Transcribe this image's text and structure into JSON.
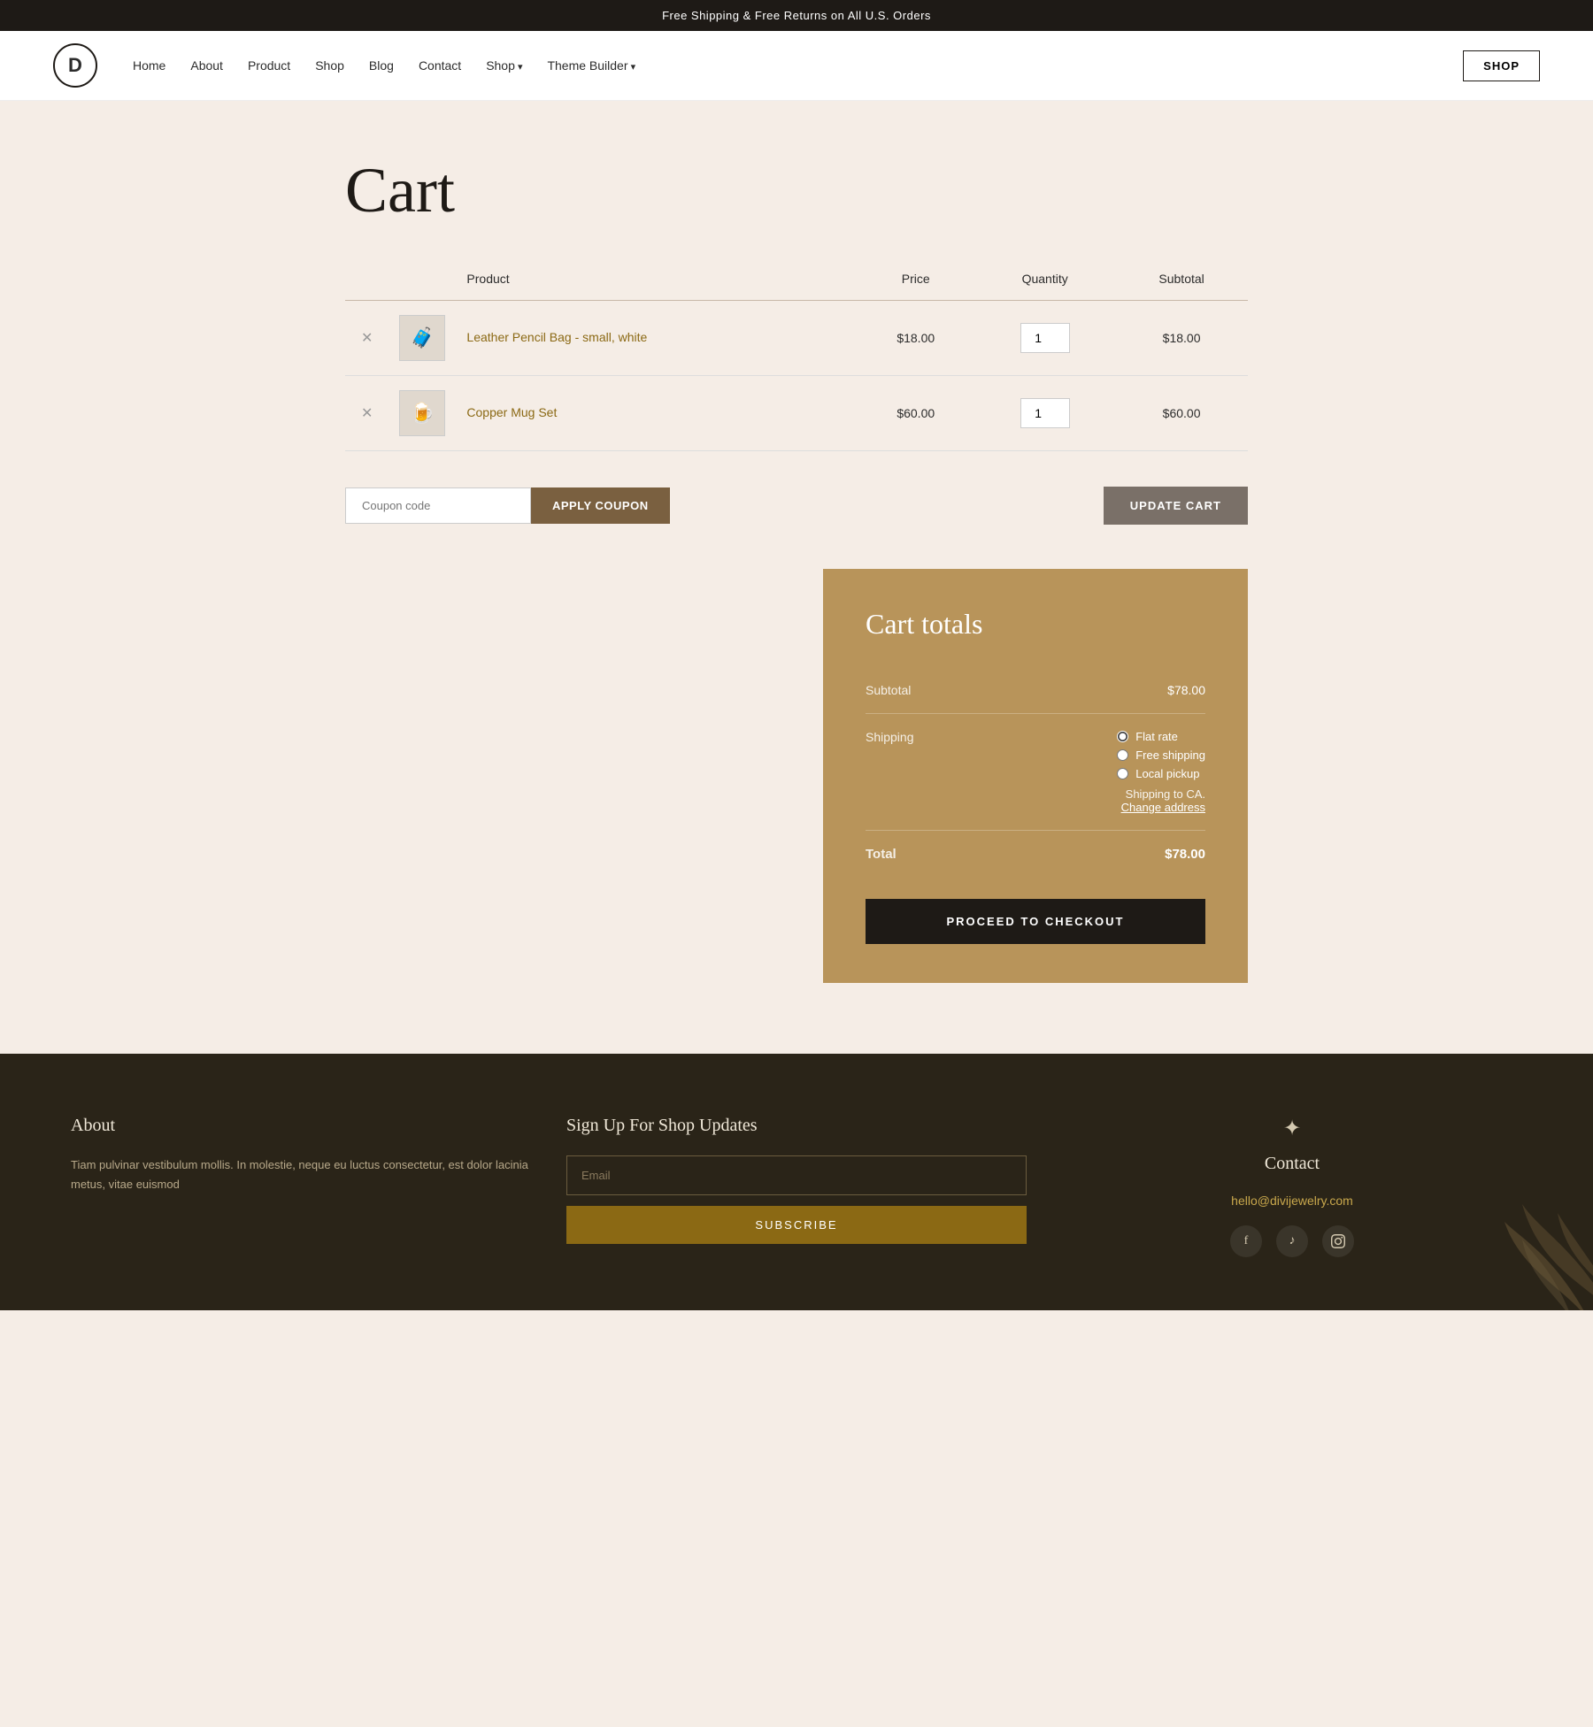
{
  "topBanner": {
    "text": "Free Shipping & Free Returns on All U.S. Orders"
  },
  "header": {
    "logo": "D",
    "nav": [
      {
        "label": "Home",
        "hasDropdown": false
      },
      {
        "label": "About",
        "hasDropdown": false
      },
      {
        "label": "Product",
        "hasDropdown": false
      },
      {
        "label": "Shop",
        "hasDropdown": false
      },
      {
        "label": "Blog",
        "hasDropdown": false
      },
      {
        "label": "Contact",
        "hasDropdown": false
      },
      {
        "label": "Shop",
        "hasDropdown": true
      },
      {
        "label": "Theme Builder",
        "hasDropdown": true
      }
    ],
    "shopButton": "SHOP"
  },
  "cartPage": {
    "title": "Cart",
    "tableHeaders": {
      "product": "Product",
      "price": "Price",
      "quantity": "Quantity",
      "subtotal": "Subtotal"
    },
    "items": [
      {
        "id": 1,
        "name": "Leather Pencil Bag - small, white",
        "price": "$18.00",
        "quantity": 1,
        "subtotal": "$18.00",
        "emoji": "🧳"
      },
      {
        "id": 2,
        "name": "Copper Mug Set",
        "price": "$60.00",
        "quantity": 1,
        "subtotal": "$60.00",
        "emoji": "🍺"
      }
    ],
    "coupon": {
      "placeholder": "Coupon code",
      "applyButton": "APPLY COUPON"
    },
    "updateCartButton": "UPDATE CART",
    "cartTotals": {
      "title": "Cart totals",
      "subtotalLabel": "Subtotal",
      "subtotalValue": "$78.00",
      "shippingLabel": "Shipping",
      "shippingOptions": [
        {
          "label": "Flat rate",
          "selected": true
        },
        {
          "label": "Free shipping",
          "selected": false
        },
        {
          "label": "Local pickup",
          "selected": false
        }
      ],
      "shippingTo": "Shipping to CA.",
      "changeAddress": "Change address",
      "totalLabel": "Total",
      "totalValue": "$78.00",
      "checkoutButton": "PROCEED TO CHECKOUT"
    }
  },
  "footer": {
    "about": {
      "title": "About",
      "text": "Tiam pulvinar vestibulum mollis. In molestie, neque eu luctus consectetur, est dolor lacinia metus, vitae euismod"
    },
    "newsletter": {
      "title": "Sign Up For Shop Updates",
      "emailPlaceholder": "Email",
      "subscribeButton": "SUBSCRIBE"
    },
    "contact": {
      "title": "Contact",
      "email": "hello@divijewelry.com",
      "socialIcons": [
        "f",
        "♪",
        "📷"
      ]
    }
  }
}
